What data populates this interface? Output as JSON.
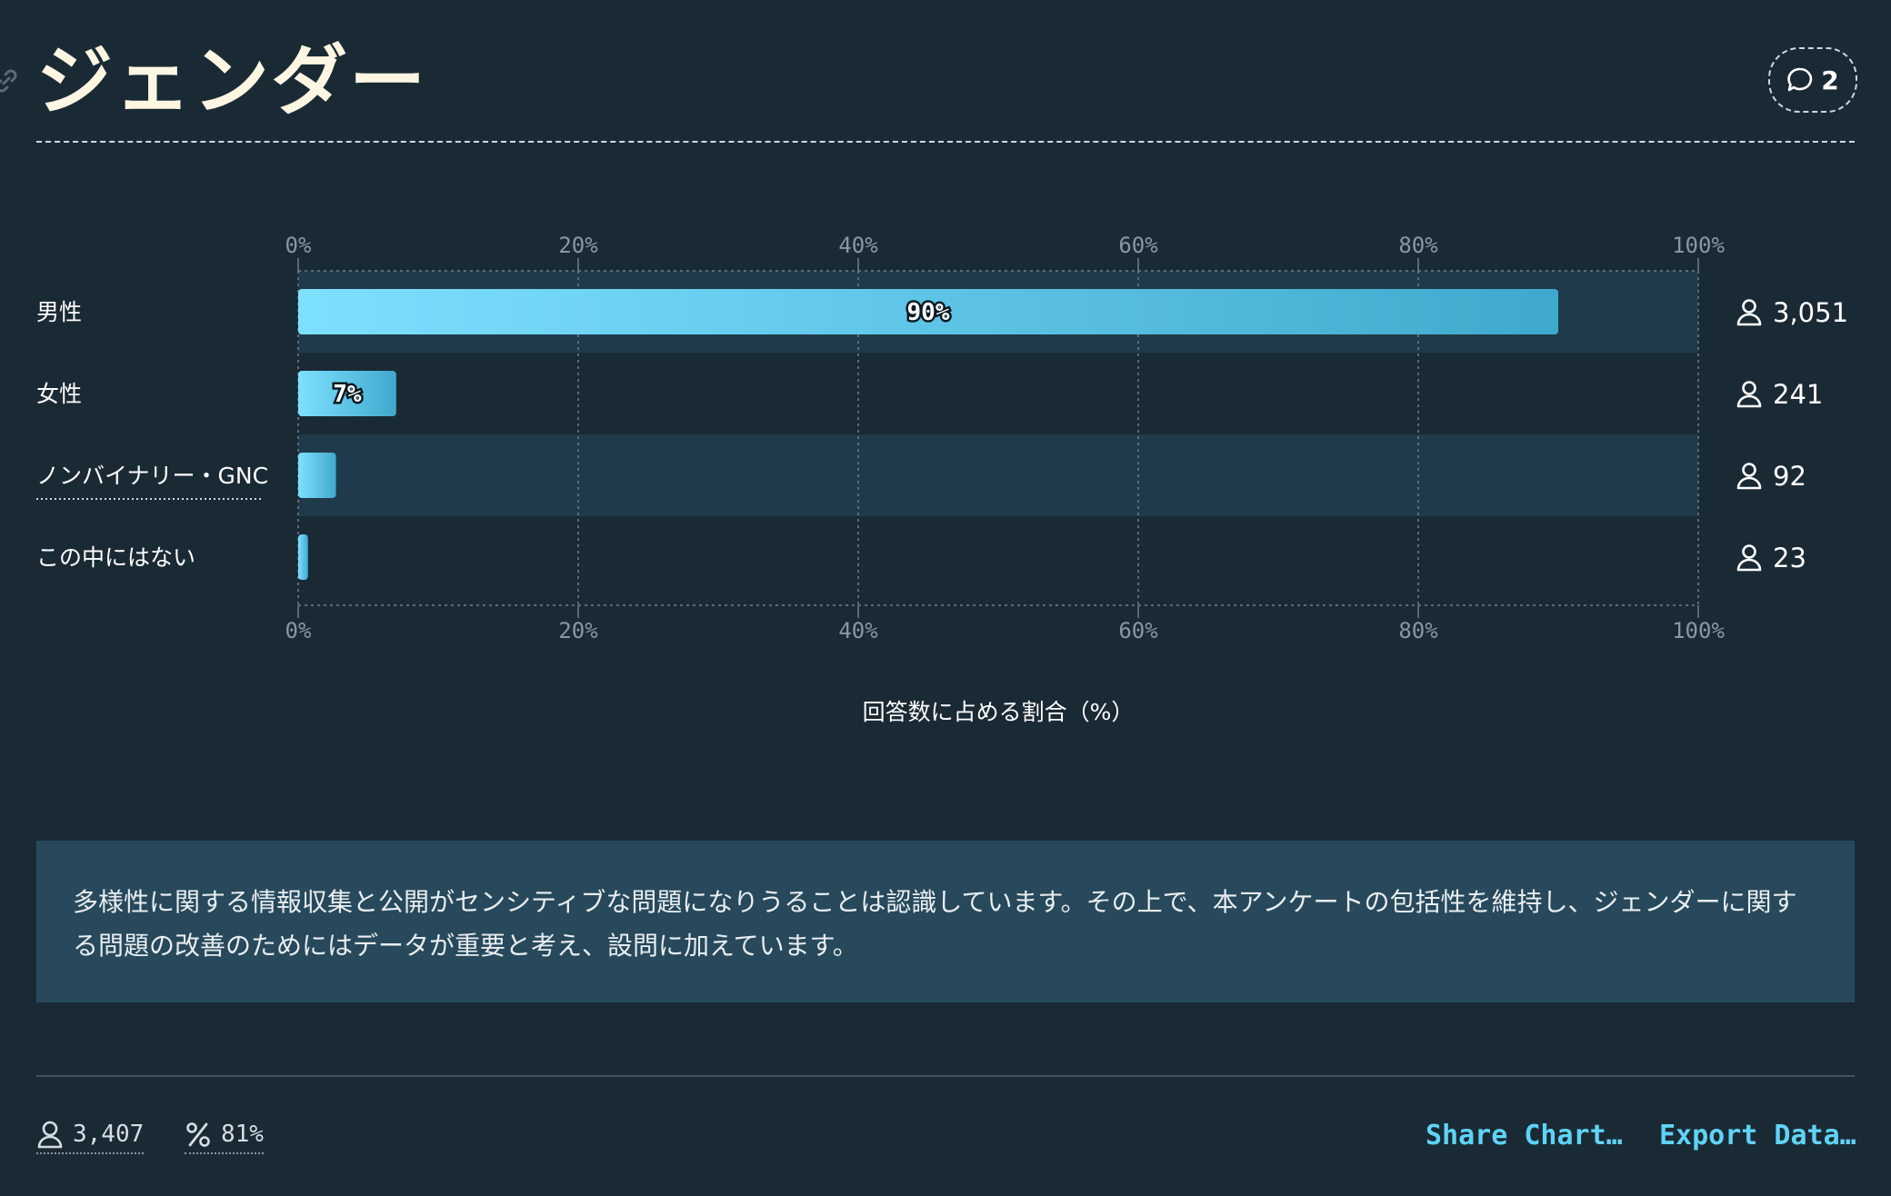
{
  "header": {
    "title": "ジェンダー",
    "comment_count": "2"
  },
  "chart_data": {
    "type": "bar",
    "orientation": "horizontal",
    "categories": [
      "男性",
      "女性",
      "ノンバイナリー・GNC",
      "この中にはない"
    ],
    "values": [
      90,
      7,
      2.7,
      0.7
    ],
    "value_labels": [
      "90%",
      "7%",
      "",
      ""
    ],
    "counts": [
      "3,051",
      "241",
      "92",
      "23"
    ],
    "xticks": [
      "0%",
      "20%",
      "40%",
      "60%",
      "80%",
      "100%"
    ],
    "xlim": [
      0,
      100
    ],
    "xlabel": "回答数に占める割合（%）",
    "grid": true,
    "colors": {
      "bar_start": "#7ee0ff",
      "bar_end": "#3fa9cd",
      "row_alt": "#1f3a4a",
      "background": "#1a2a35"
    }
  },
  "note": "多様性に関する情報収集と公開がセンシティブな問題になりうることは認識しています。その上で、本アンケートの包括性を維持し、ジェンダーに関する問題の改善のためにはデータが重要と考え、設問に加えています。",
  "footer": {
    "respondents": "3,407",
    "percentage": "81%",
    "share_label": "Share Chart…",
    "export_label": "Export Data…"
  }
}
